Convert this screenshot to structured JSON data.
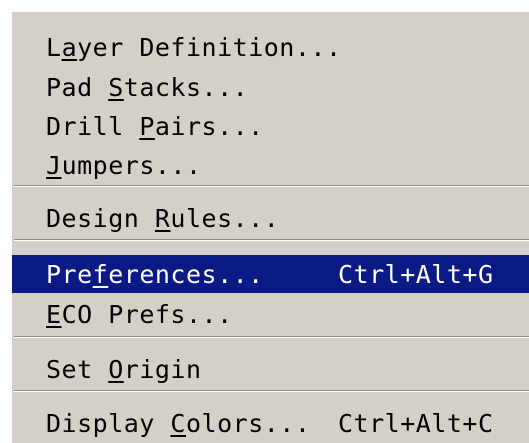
{
  "menu": {
    "items": [
      {
        "pre": "L",
        "mn": "a",
        "post": "yer Definition...",
        "shortcut": "",
        "highlighted": false
      },
      {
        "pre": "Pad ",
        "mn": "S",
        "post": "tacks...",
        "shortcut": "",
        "highlighted": false
      },
      {
        "pre": "Drill ",
        "mn": "P",
        "post": "airs...",
        "shortcut": "",
        "highlighted": false
      },
      {
        "pre": "",
        "mn": "J",
        "post": "umpers...",
        "shortcut": "",
        "highlighted": false
      },
      {
        "pre": "Design ",
        "mn": "R",
        "post": "ules...",
        "shortcut": "",
        "highlighted": false
      },
      {
        "pre": "Pre",
        "mn": "f",
        "post": "erences...",
        "shortcut": "Ctrl+Alt+G",
        "highlighted": true
      },
      {
        "pre": "",
        "mn": "E",
        "post": "CO Prefs...",
        "shortcut": "",
        "highlighted": false
      },
      {
        "pre": "Set ",
        "mn": "O",
        "post": "rigin",
        "shortcut": "",
        "highlighted": false
      },
      {
        "pre": "Display ",
        "mn": "C",
        "post": "olors...",
        "shortcut": "Ctrl+Alt+C",
        "highlighted": false
      }
    ],
    "colors": {
      "background": "#d4d0c8",
      "highlight": "#0a1a84",
      "highlight_text": "#ffffff"
    }
  }
}
